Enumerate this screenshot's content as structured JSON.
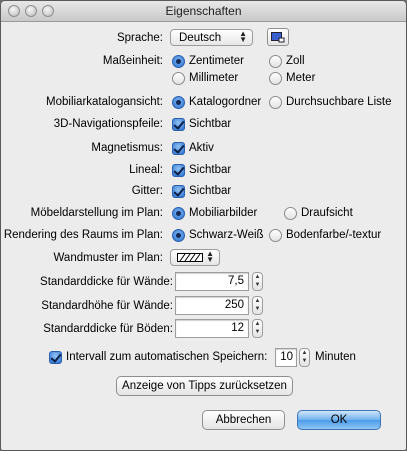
{
  "window": {
    "title": "Eigenschaften"
  },
  "language": {
    "label": "Sprache:",
    "value": "Deutsch"
  },
  "unit": {
    "label": "Maßeinheit:",
    "options": [
      "Zentimeter",
      "Zoll",
      "Millimeter",
      "Meter"
    ],
    "selected": "Zentimeter"
  },
  "catalog_view": {
    "label": "Mobiliarkatalogansicht:",
    "options": [
      "Katalogordner",
      "Durchsuchbare Liste"
    ],
    "selected": "Katalogordner"
  },
  "nav_arrows": {
    "label": "3D-Navigationspfeile:",
    "text": "Sichtbar",
    "checked": true
  },
  "magnetism": {
    "label": "Magnetismus:",
    "text": "Aktiv",
    "checked": true
  },
  "ruler": {
    "label": "Lineal:",
    "text": "Sichtbar",
    "checked": true
  },
  "grid": {
    "label": "Gitter:",
    "text": "Sichtbar",
    "checked": true
  },
  "furniture_plan": {
    "label": "Möbeldarstellung im Plan:",
    "options": [
      "Mobiliarbilder",
      "Draufsicht"
    ],
    "selected": "Mobiliarbilder"
  },
  "room_render": {
    "label": "Rendering des Raums im Plan:",
    "options": [
      "Schwarz-Weiß",
      "Bodenfarbe/-textur"
    ],
    "selected": "Schwarz-Weiß"
  },
  "wall_pattern": {
    "label": "Wandmuster im Plan:"
  },
  "wall_thickness": {
    "label": "Standarddicke für Wände:",
    "value": "7,5"
  },
  "wall_height": {
    "label": "Standardhöhe für Wände:",
    "value": "250"
  },
  "floor_thickness": {
    "label": "Standarddicke für Böden:",
    "value": "12"
  },
  "autosave": {
    "label": "Intervall zum automatischen Speichern:",
    "value": "10",
    "unit": "Minuten",
    "checked": true
  },
  "reset_tips": {
    "label": "Anzeige von Tipps zurücksetzen"
  },
  "buttons": {
    "cancel": "Abbrechen",
    "ok": "OK"
  },
  "colors": {
    "accent": "#2a6fd1",
    "window_bg": "#ececec"
  }
}
